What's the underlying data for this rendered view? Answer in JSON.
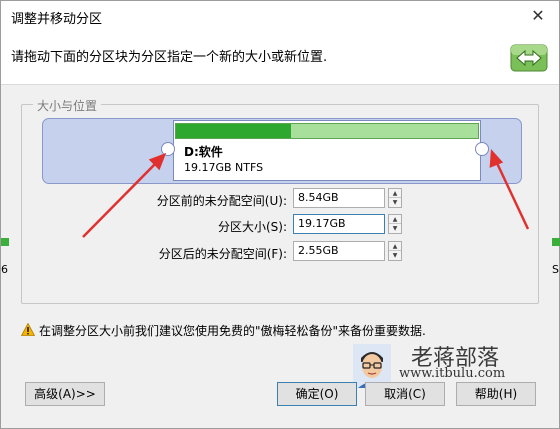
{
  "window": {
    "title": "调整并移动分区",
    "close_glyph": "✕"
  },
  "header": {
    "instruction": "请拖动下面的分区块为分区指定一个新的大小或新位置."
  },
  "group": {
    "label": "大小与位置"
  },
  "partition": {
    "name": "D:软件",
    "detail": "19.17GB NTFS",
    "used_fraction": 0.38
  },
  "fields": {
    "before": {
      "label": "分区前的未分配空间(U):",
      "value": "8.54GB"
    },
    "size": {
      "label": "分区大小(S):",
      "value": "19.17GB"
    },
    "after": {
      "label": "分区后的未分配空间(F):",
      "value": "2.55GB"
    }
  },
  "side_text": {
    "left": "6",
    "right": "S"
  },
  "warning": {
    "text": "在调整分区大小前我们建议您使用免费的\"傲梅轻松备份\"来备份重要数据."
  },
  "buttons": {
    "advanced": "高级(A)>>",
    "ok": "确定(O)",
    "cancel": "取消(C)",
    "help": "帮助(H)"
  },
  "watermark": {
    "title": "老蒋部落",
    "url": "www.itbulu.com"
  },
  "colors": {
    "used": "#2fa82f",
    "free": "#a8df9a",
    "track": "#c6d1ee",
    "arrow": "#e0312f"
  }
}
